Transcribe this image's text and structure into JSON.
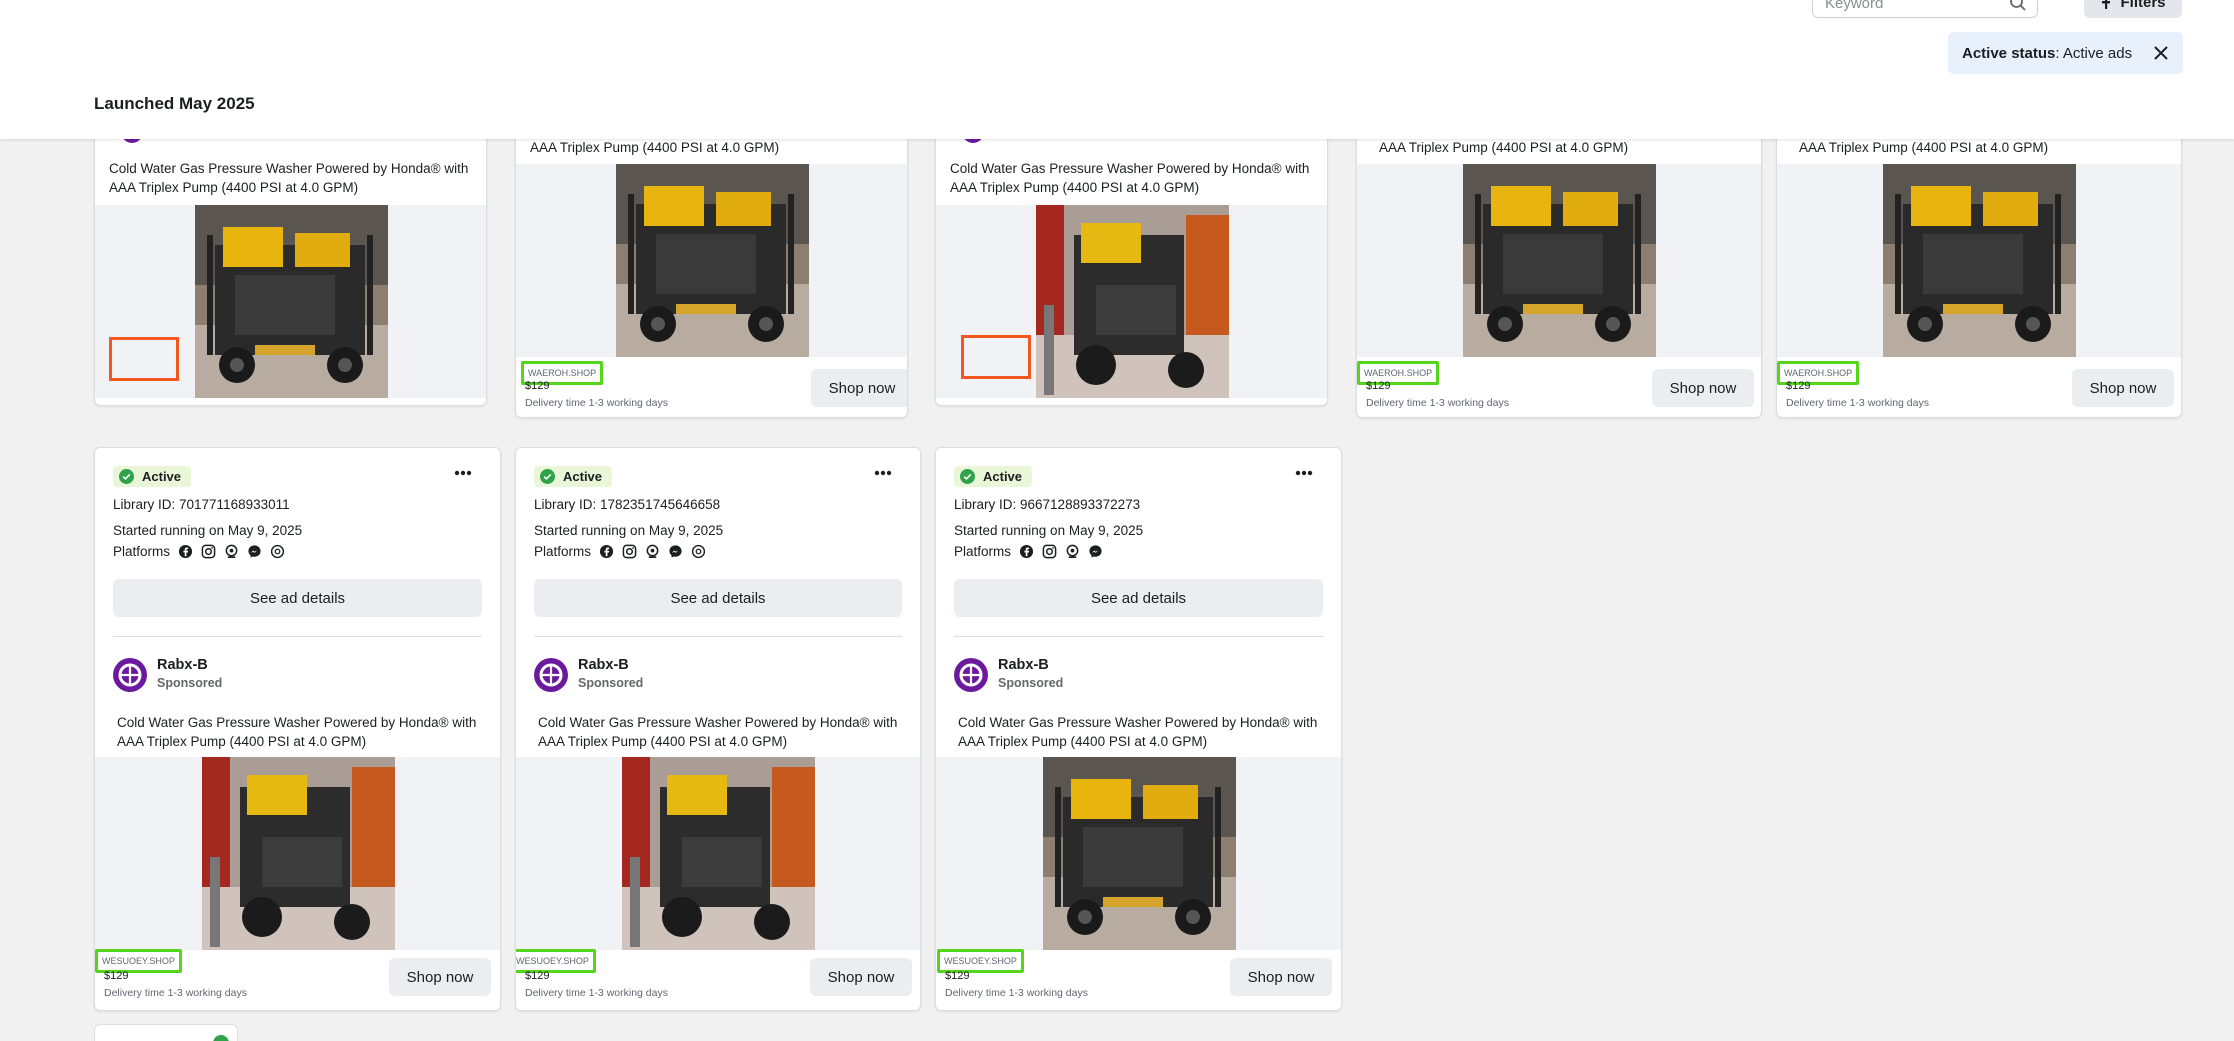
{
  "header": {
    "search_placeholder": "Keyword",
    "filters_label": "Filters",
    "active_filter_key": "Active status",
    "active_filter_value": ": Active ads",
    "section_title": "Launched May 2025"
  },
  "colors": {
    "highlight_green": "#54d61a",
    "highlight_orange": "#f2571f",
    "active_green": "#31a24c",
    "avatar_purple": "#6b1a9e"
  },
  "top_cards": [
    {
      "text": "Cold Water Gas Pressure Washer Powered by Honda® with AAA Triplex Pump (4400 PSI at 4.0 GPM)",
      "footer": false
    },
    {
      "text": "AAA Triplex Pump (4400 PSI at 4.0 GPM)",
      "footer": true,
      "domain": "WAEROH.SHOP",
      "price": "$129",
      "delivery": "Delivery time 1-3 working days",
      "button": "Shop now"
    },
    {
      "text": "Cold Water Gas Pressure Washer Powered by Honda® with AAA Triplex Pump (4400 PSI at 4.0 GPM)",
      "footer": false
    },
    {
      "text": "AAA Triplex Pump (4400 PSI at 4.0 GPM)",
      "footer": true,
      "domain": "WAEROH.SHOP",
      "price": "$129",
      "delivery": "Delivery time 1-3 working days",
      "button": "Shop now"
    },
    {
      "text": "AAA Triplex Pump (4400 PSI at 4.0 GPM)",
      "footer": true,
      "domain": "WAEROH.SHOP",
      "price": "$129",
      "delivery": "Delivery time 1-3 working days",
      "button": "Shop now"
    }
  ],
  "cards": [
    {
      "status": "Active",
      "library_id": "Library ID: 701771168933011",
      "started": "Started running on May 9, 2025",
      "platforms_label": "Platforms",
      "platforms": [
        "facebook-icon",
        "instagram-icon",
        "audience-network-icon",
        "messenger-icon",
        "threads-icon"
      ],
      "details_button": "See ad details",
      "advertiser": "Rabx-B",
      "sponsored": "Sponsored",
      "text": "Cold Water Gas Pressure Washer Powered by Honda® with AAA Triplex Pump (4400 PSI at 4.0 GPM)",
      "domain": "WESUOEY.SHOP",
      "price": "$129",
      "delivery": "Delivery time 1-3 working days",
      "button": "Shop now"
    },
    {
      "status": "Active",
      "library_id": "Library ID: 1782351745646658",
      "started": "Started running on May 9, 2025",
      "platforms_label": "Platforms",
      "platforms": [
        "facebook-icon",
        "instagram-icon",
        "audience-network-icon",
        "messenger-icon",
        "threads-icon"
      ],
      "details_button": "See ad details",
      "advertiser": "Rabx-B",
      "sponsored": "Sponsored",
      "text": "Cold Water Gas Pressure Washer Powered by Honda® with AAA Triplex Pump (4400 PSI at 4.0 GPM)",
      "domain": "WESUOEY.SHOP",
      "price": "$129",
      "delivery": "Delivery time 1-3 working days",
      "button": "Shop now"
    },
    {
      "status": "Active",
      "library_id": "Library ID: 9667128893372273",
      "started": "Started running on May 9, 2025",
      "platforms_label": "Platforms",
      "platforms": [
        "facebook-icon",
        "instagram-icon",
        "audience-network-icon",
        "messenger-icon"
      ],
      "details_button": "See ad details",
      "advertiser": "Rabx-B",
      "sponsored": "Sponsored",
      "text": "Cold Water Gas Pressure Washer Powered by Honda® with AAA Triplex Pump (4400 PSI at 4.0 GPM)",
      "domain": "WESUOEY.SHOP",
      "price": "$129",
      "delivery": "Delivery time 1-3 working days",
      "button": "Shop now"
    }
  ]
}
